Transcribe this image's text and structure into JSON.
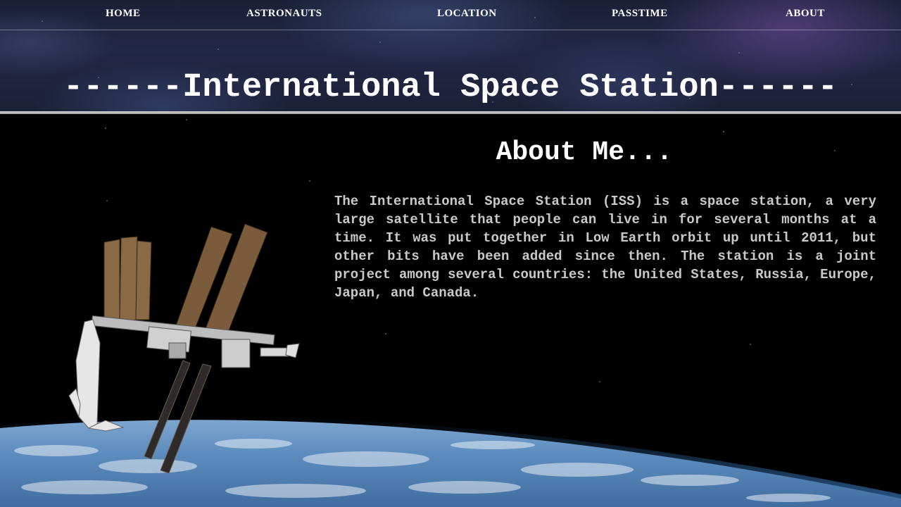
{
  "nav": {
    "items": [
      {
        "label": "HOME"
      },
      {
        "label": "ASTRONAUTS"
      },
      {
        "label": "LOCATION"
      },
      {
        "label": "PASSTIME"
      },
      {
        "label": "ABOUT"
      }
    ]
  },
  "header": {
    "title": "------International Space Station------"
  },
  "about": {
    "heading": "About Me...",
    "body": "The International Space Station (ISS) is a space station, a very large satellite that people can live in for several months at a time. It was put together in Low Earth orbit up until 2011, but other bits have been added since then. The station is a joint project among several countries: the United States, Russia, Europe, Japan, and Canada."
  },
  "colors": {
    "header_background": "#1f2340",
    "main_background": "#000000",
    "body_text": "#c9c9c9",
    "heading_text": "#ffffff",
    "earth_blue": "#5f8fc0"
  }
}
